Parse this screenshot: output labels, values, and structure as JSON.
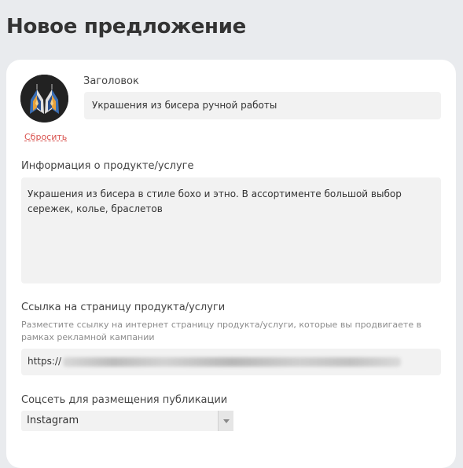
{
  "page": {
    "title": "Новое предложение"
  },
  "header_section": {
    "avatar_icon": "beaded-earrings-image",
    "reset_label": "Сбросить",
    "title_label": "Заголовок",
    "title_value": "Украшения из бисера ручной работы"
  },
  "info_section": {
    "label": "Информация о продукте/услуге",
    "value": "Украшения из бисера в стиле бохо и этно. В ассортименте большой выбор сережек, колье, браслетов"
  },
  "link_section": {
    "label": "Ссылка на страницу продукта/услуги",
    "hint": "Разместите ссылку на интернет страницу продукта/услуги, которые вы продвигаете в рамках рекламной кампании",
    "value_prefix": "https://"
  },
  "social_section": {
    "label": "Соцсеть для размещения публикации",
    "selected": "Instagram"
  },
  "colors": {
    "background": "#e9ebee",
    "card": "#ffffff",
    "field": "#f2f2f2",
    "reset_link": "#d9534f"
  }
}
